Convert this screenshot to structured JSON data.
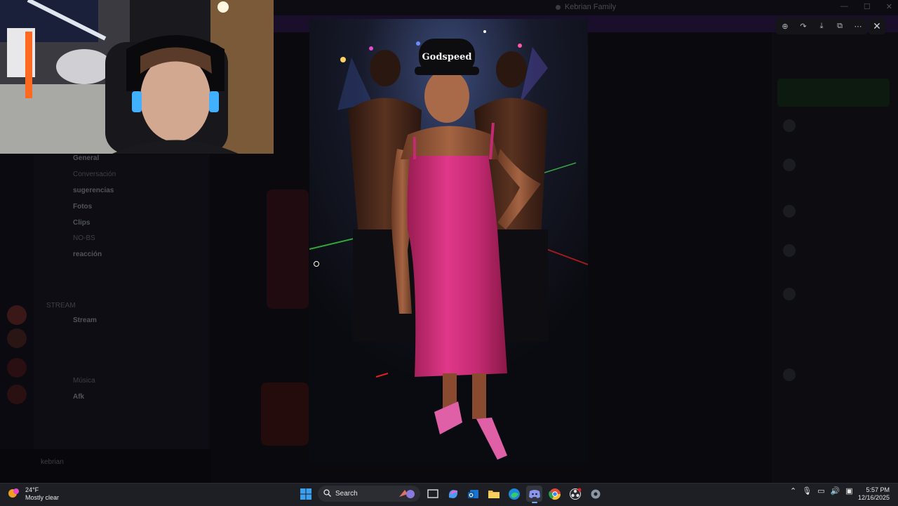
{
  "window": {
    "title": "Kebrian Family",
    "min_glyph": "—",
    "max_glyph": "☐",
    "close_glyph": "✕"
  },
  "viewer": {
    "toolbar": [
      {
        "name": "zoom-icon",
        "glyph": "⊕"
      },
      {
        "name": "forward-icon",
        "glyph": "↷"
      },
      {
        "name": "download-icon",
        "glyph": "⤓"
      },
      {
        "name": "open-external-icon",
        "glyph": "⧉"
      },
      {
        "name": "more-icon",
        "glyph": "⋯"
      }
    ],
    "close_glyph": "✕",
    "photo_hat_text": "Godspeed"
  },
  "discord_bg": {
    "channels": [
      {
        "label": "General",
        "bold": true
      },
      {
        "label": "Conversación",
        "bold": false
      },
      {
        "label": "sugerencias",
        "bold": true
      },
      {
        "label": "Fotos",
        "bold": true
      },
      {
        "label": "Clips",
        "bold": true
      },
      {
        "label": "NO-BS",
        "bold": false
      },
      {
        "label": "reacción",
        "bold": true
      },
      {
        "label": "STREAM",
        "bold": false
      },
      {
        "label": "Stream",
        "bold": true
      },
      {
        "label": "Música",
        "bold": false
      },
      {
        "label": "Afk",
        "bold": true
      }
    ],
    "user_name": "kebrian"
  },
  "taskbar": {
    "weather": {
      "temp": "24°F",
      "condition": "Mostly clear"
    },
    "search_label": "Search",
    "clock": {
      "time": "5:57 PM",
      "date": "12/16/2025"
    }
  },
  "colors": {
    "dress": "#d12d78",
    "taskbar": "#1d1f24",
    "accent": "#7aa7ff"
  }
}
